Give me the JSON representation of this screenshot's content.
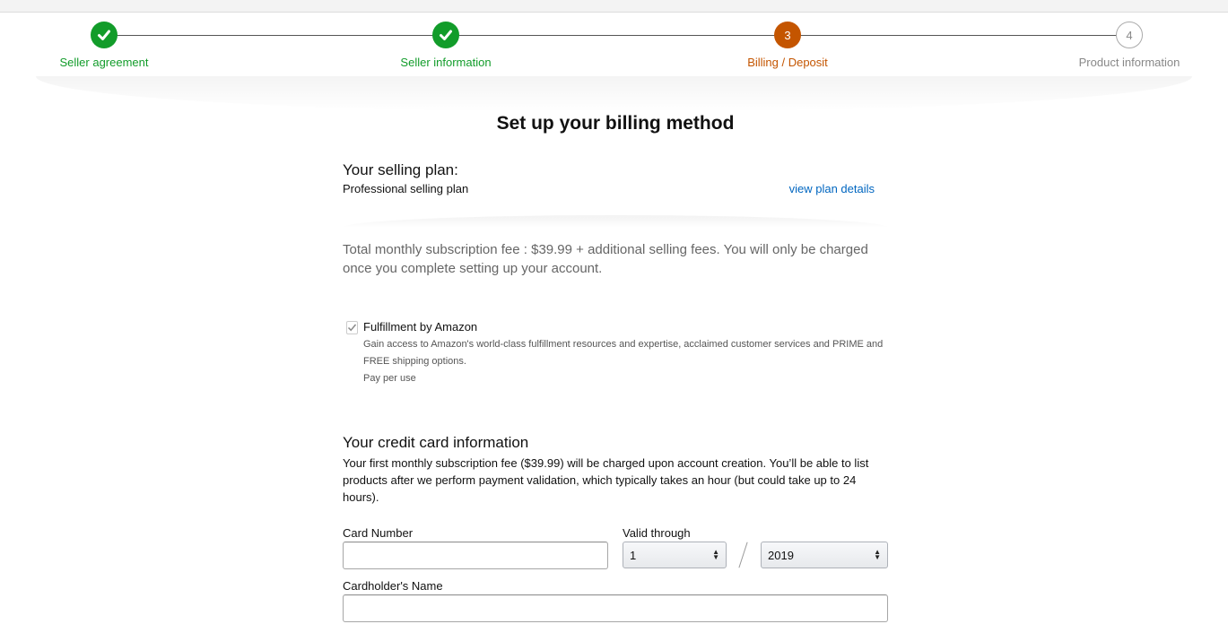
{
  "stepper": {
    "steps": [
      {
        "label": "Seller agreement",
        "state": "done",
        "number": ""
      },
      {
        "label": "Seller information",
        "state": "done",
        "number": ""
      },
      {
        "label": "Billing / Deposit",
        "state": "current",
        "number": "3"
      },
      {
        "label": "Product information",
        "state": "pending",
        "number": "4"
      }
    ]
  },
  "page": {
    "title": "Set up your billing method"
  },
  "plan": {
    "heading": "Your selling plan:",
    "name": "Professional selling plan",
    "details_link": "view plan details",
    "fee_text": "Total monthly subscription fee : $39.99 + additional selling fees. You will only be charged once you complete setting up your account."
  },
  "fba": {
    "checked": true,
    "title": "Fulfillment by Amazon",
    "description": "Gain access to Amazon's world-class fulfillment resources and expertise, acclaimed customer services and PRIME and FREE shipping options.",
    "pricing": "Pay per use"
  },
  "credit_card": {
    "heading": "Your credit card information",
    "text": "Your first monthly subscription fee ($39.99) will be charged upon account creation. You’ll be able to list products after we perform payment validation, which typically takes an hour (but could take up to 24 hours).",
    "card_number_label": "Card Number",
    "card_number_value": "",
    "valid_through_label": "Valid through",
    "month_value": "1",
    "year_value": "2019",
    "cardholder_label": "Cardholder's Name",
    "cardholder_value": ""
  },
  "colors": {
    "done": "#129c2a",
    "current": "#c45500",
    "pending": "#888888",
    "link": "#0066c0"
  },
  "icons": {
    "done_step": "check-icon",
    "fba_checkbox": "checkmark-icon",
    "select": "up-down-arrows-icon"
  }
}
